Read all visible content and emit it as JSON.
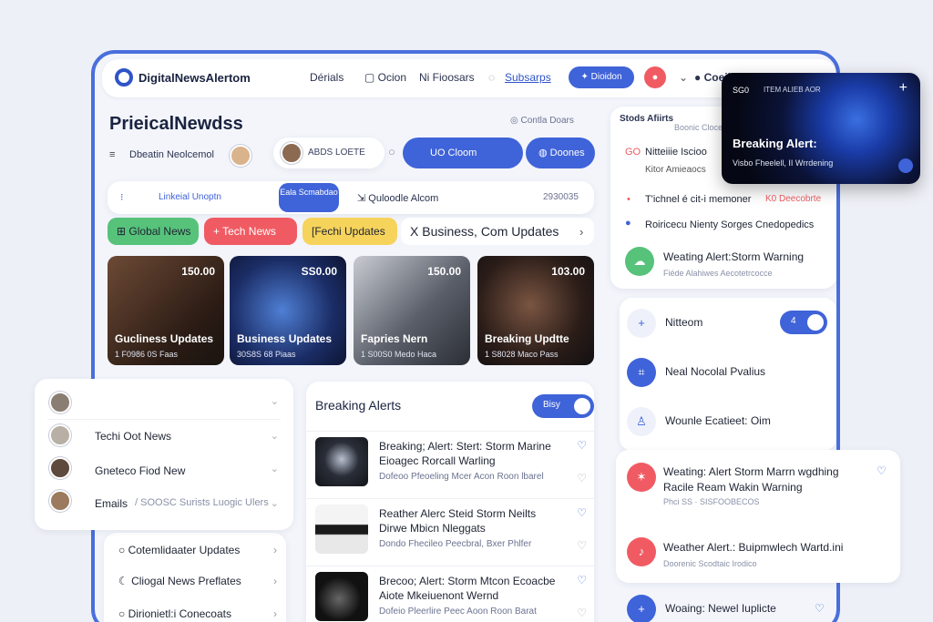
{
  "header": {
    "brand": "DigitalNewsAlertom",
    "nav": [
      "Dérials",
      "Ocion",
      "Ni Fioosars",
      "Subsarps"
    ],
    "pill": "Dioidon",
    "user": "Coeilit"
  },
  "page": {
    "title": "PrieicalNewdss",
    "control_label": "Contla Doars",
    "filter_label": "Dbeatin Neolcemol",
    "search_placeholder": "ABDS LOETE",
    "btn_primary": "UO Cloom",
    "btn_secondary": "Doones"
  },
  "updates_bar": {
    "left": "Linkeial Unoptn",
    "tag": "Eala Scmabdao",
    "middle": "Quloodle Alcom",
    "right": "2930035"
  },
  "chips": [
    "Global News",
    "Tech News",
    "[Fechi Updates",
    "X Business, Com Updates"
  ],
  "tiles": [
    {
      "title": "Gucliness Updates",
      "sub": "1 F0986 0S Faas",
      "num": "150.00"
    },
    {
      "title": "Business Updates",
      "sub": "30S8S 68 Piaas",
      "num": "SS0.00"
    },
    {
      "title": "Fapries Nern",
      "sub": "1 S00S0 Medo Haca",
      "num": "150.00"
    },
    {
      "title": "Breaking Updtte",
      "sub": "1 S8028 Maco Pass",
      "num": "103.00"
    }
  ],
  "breaking": {
    "title": "Breaking Alerts",
    "toggle": "Bisy",
    "items": [
      {
        "title": "Breaking; Alert: Stert: Storm Marine Eioagec Rorcall Warling",
        "sub": "Dofeoo Pfeoeling Mcer Acon Roon lbarel"
      },
      {
        "title": "Reather Alerc Steid Storm Neilts Dirwe Mbicn Nleggats",
        "sub": "Dondo Fhecileo Peecbral, Bxer Phlfer"
      },
      {
        "title": "Brecoo; Alert: Storm Mtcon Ecoacbe Aiote Mkeiuenont Wernd",
        "sub": "Dofeio Pleerlire Peec Aoon Roon Barat"
      }
    ]
  },
  "left_popup": {
    "items": [
      "",
      "Techi Oot News",
      "Gneteco Fiod New",
      "Emails"
    ],
    "emails_sub": "SOOSC Surists Luogic Ulers"
  },
  "left_list": [
    "Cotemlidaater Updates",
    "Cliogal News Preflates",
    "Dirionietl:i Conecoats"
  ],
  "side": {
    "title": "Stods Afiirts",
    "title_sub": "Boonic Cloces",
    "rows": [
      {
        "code": "GO",
        "text": "Nitteiiie Iscioo"
      },
      {
        "code": "",
        "text": "Kitor Amieaocs"
      },
      {
        "code": "",
        "text": "T'ichnel é cit-i memoner",
        "alert": "K0 Deecobrte"
      },
      {
        "code": "",
        "text": "Roiricecu Nienty Sorges Cnedopedics"
      }
    ],
    "weather_card": {
      "title": "Weating Alert:Storm Warning",
      "sub": "Fiéde Alahiwes Aecotetrcocce"
    }
  },
  "notif_card": {
    "label": "SG0",
    "source": "ITEM ALIEB AOR",
    "title": "Breaking Alert:",
    "sub": "Visbo Fheelell, II Wrrdening"
  },
  "settings": {
    "rows": [
      {
        "label": "Nitteom",
        "toggle": "4"
      },
      {
        "label": "Neal Nocolal Pvalius"
      },
      {
        "label": "Wounle Ecatieet: Oim"
      }
    ]
  },
  "alerts_panel": {
    "items": [
      {
        "title": "Weating: Alert Storm Marrn wgdhing Racile Ream Wakin Warning",
        "sub": "Phci SS · SISFOOBECOS"
      },
      {
        "title": "Weather Alert.: Buipmwlech Wartd.ini",
        "sub": "Doorenic Scodtaic Irodico"
      }
    ]
  },
  "bottom_right": {
    "title": "Woaing: Newel Iuplicte"
  },
  "colors": {
    "accent": "#3f63d8",
    "frame": "#4a6fdc",
    "red": "#f05b63",
    "green": "#56c27a",
    "yellow": "#f6d35b"
  }
}
